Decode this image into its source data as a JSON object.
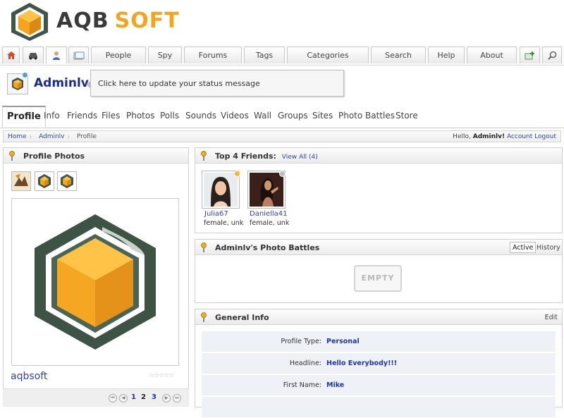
{
  "brand": {
    "name_part1": "AQB",
    "name_part2": "SOFT",
    "accent": "#f4a41f"
  },
  "top_nav": {
    "icons": [
      "home-icon",
      "car-icon",
      "user-icon",
      "messages-icon"
    ],
    "items": [
      "People",
      "Spy",
      "Forums",
      "Tags",
      "Categories",
      "Search",
      "Help",
      "About"
    ],
    "right_icons": [
      "add-photo-icon",
      "zoom-icon"
    ]
  },
  "user": {
    "name": "Adminlv",
    "status_prompt": "Click here to update your status message"
  },
  "profile_tabs": [
    "Profile",
    "Info",
    "Friends",
    "Files",
    "Photos",
    "Polls",
    "Sounds",
    "Videos",
    "Wall",
    "Groups",
    "Sites",
    "Photo Battles",
    "Store"
  ],
  "breadcrumb": {
    "items": [
      "Home",
      "Adminlv",
      "Profile"
    ],
    "hello_prefix": "Hello,",
    "hello_name": "Adminlv!",
    "account_link": "Account",
    "logout_link": "Logout"
  },
  "profile_photos": {
    "title": "Profile Photos",
    "photo_name": "aqbsoft",
    "stars": "☆☆☆☆☆",
    "pager": {
      "pages": [
        "1",
        "2",
        "3"
      ],
      "current": "2"
    }
  },
  "top_friends": {
    "title": "Top 4 Friends:",
    "view_all": "View All (4)",
    "friends": [
      {
        "name": "Julia67",
        "info": "female, unk",
        "status_color": "#f2b632"
      },
      {
        "name": "Daniella41",
        "info": "female, unk",
        "status_color": "#bdbdbd"
      }
    ]
  },
  "photo_battles": {
    "title": "Adminlv's Photo Battles",
    "tabs": [
      "Active",
      "History"
    ],
    "empty_label": "EMPTY"
  },
  "general_info": {
    "title": "General Info",
    "edit_label": "Edit",
    "rows": [
      {
        "label": "Profile Type:",
        "value": "Personal"
      },
      {
        "label": "Headline:",
        "value": "Hello Everybody!!!"
      },
      {
        "label": "First Name:",
        "value": "Mike"
      }
    ]
  }
}
